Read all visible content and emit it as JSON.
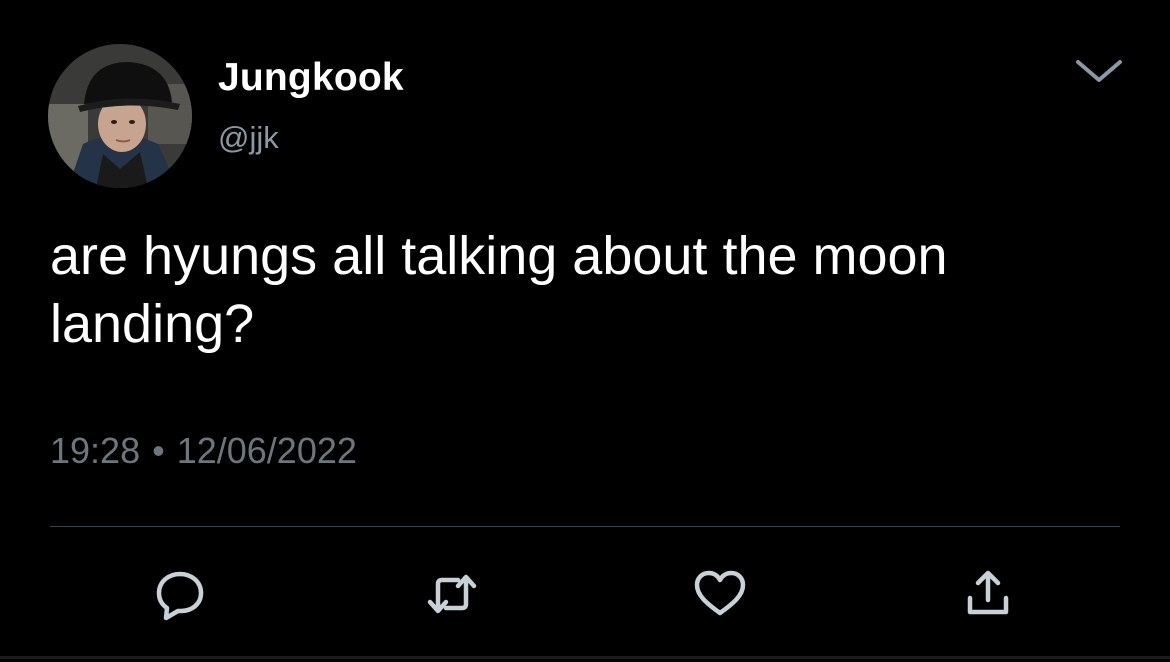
{
  "tweet": {
    "display_name": "Jungkook",
    "handle": "@jjk",
    "text_line1": "are hyungs all talking about the moon",
    "text_line2": "landing?",
    "time": "19:28",
    "separator": "•",
    "date": "12/06/2022"
  },
  "actions": [
    {
      "name": "reply",
      "icon": "reply-icon"
    },
    {
      "name": "retweet",
      "icon": "retweet-icon"
    },
    {
      "name": "like",
      "icon": "heart-icon"
    },
    {
      "name": "share",
      "icon": "share-icon"
    }
  ],
  "colors": {
    "background": "#000000",
    "text": "#ffffff",
    "secondary_text": "#8b98a5",
    "meta_text": "#6e767d",
    "icon": "#c8d0d8",
    "divider": "#38444d"
  }
}
